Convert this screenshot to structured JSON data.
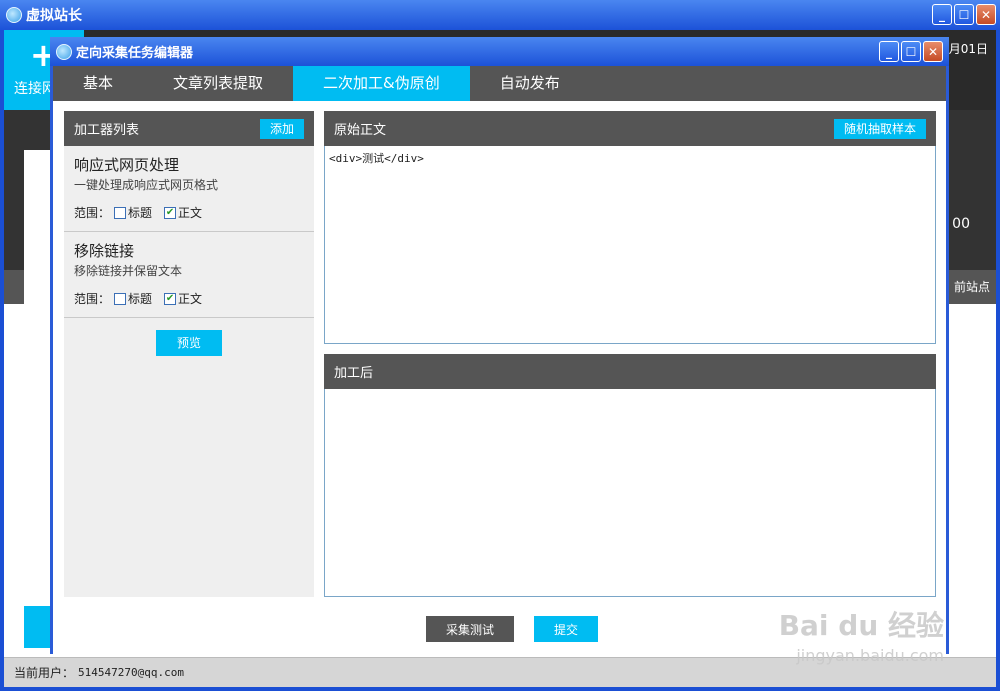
{
  "outer_window": {
    "title": "虚拟站长",
    "connect_label": "连接网",
    "date_fragment": "月01日",
    "amount_fragment": "00",
    "site_fragment": "前站点",
    "status": {
      "label": "当前用户：",
      "value": "514547270@qq.com"
    }
  },
  "dialog": {
    "title": "定向采集任务编辑器",
    "tabs": [
      {
        "label": "基本",
        "active": false
      },
      {
        "label": "文章列表提取",
        "active": false
      },
      {
        "label": "二次加工&伪原创",
        "active": true
      },
      {
        "label": "自动发布",
        "active": false
      }
    ],
    "processor_list": {
      "title": "加工器列表",
      "add_label": "添加",
      "items": [
        {
          "title": "响应式网页处理",
          "desc": "一键处理成响应式网页格式",
          "scope_label": "范围：",
          "opt_title": "标题",
          "opt_title_checked": false,
          "opt_body": "正文",
          "opt_body_checked": true
        },
        {
          "title": "移除链接",
          "desc": "移除链接并保留文本",
          "scope_label": "范围：",
          "opt_title": "标题",
          "opt_title_checked": false,
          "opt_body": "正文",
          "opt_body_checked": true
        }
      ],
      "preview_label": "预览"
    },
    "original": {
      "title": "原始正文",
      "sample_label": "随机抽取样本",
      "text": "<div>测试</div>"
    },
    "processed": {
      "title": "加工后",
      "text": ""
    },
    "footer": {
      "test_label": "采集测试",
      "submit_label": "提交"
    }
  },
  "watermark": {
    "main": "Bai du 经验",
    "sub": "jingyan.baidu.com"
  },
  "colors": {
    "accent": "#00bcf2",
    "header_dark": "#555555",
    "titlebar_blue": "#1c52d8"
  }
}
